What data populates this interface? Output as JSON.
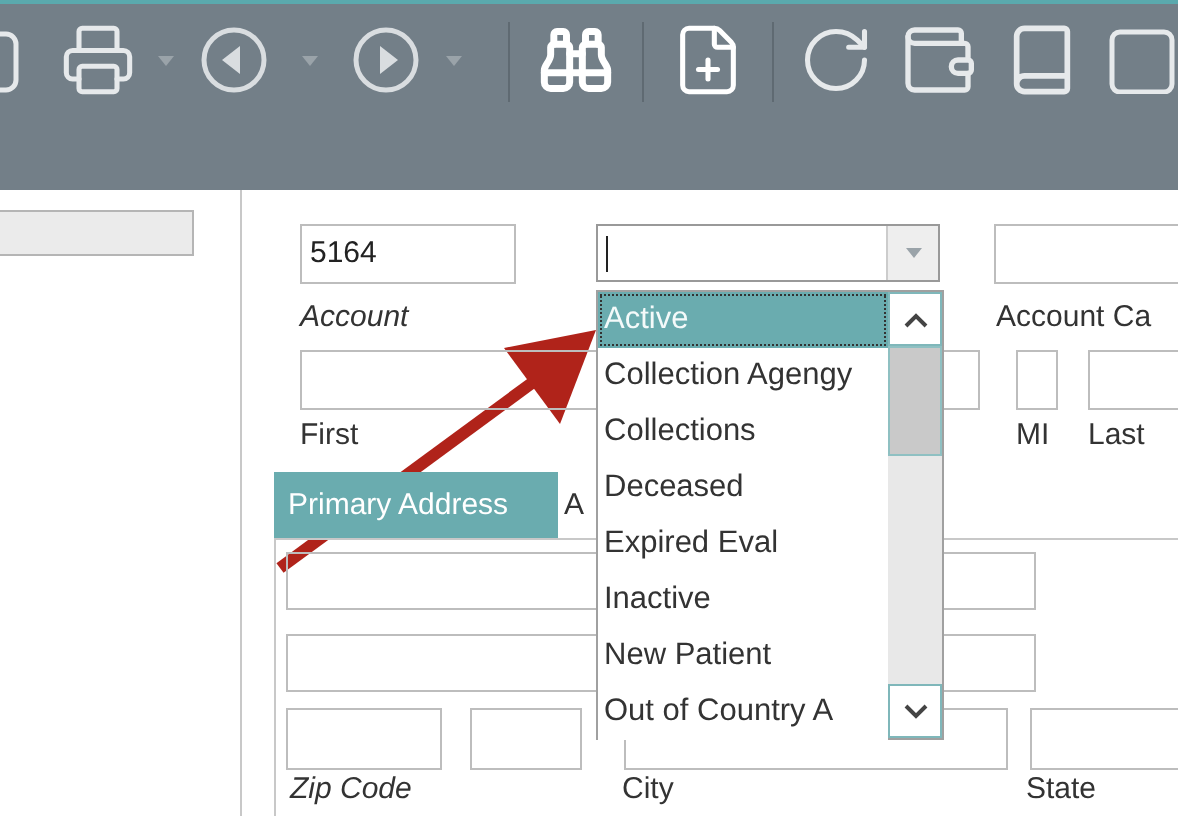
{
  "account": {
    "value": "5164",
    "label": "Account"
  },
  "status_combo": {
    "focused": true
  },
  "status_options": [
    {
      "label": "Active",
      "selected": true
    },
    {
      "label": "Collection Agengy",
      "selected": false
    },
    {
      "label": "Collections",
      "selected": false
    },
    {
      "label": "Deceased",
      "selected": false
    },
    {
      "label": "Expired Eval",
      "selected": false
    },
    {
      "label": "Inactive",
      "selected": false
    },
    {
      "label": "New Patient",
      "selected": false
    },
    {
      "label": "Out of Country A",
      "selected": false
    }
  ],
  "account_category": {
    "label": "Account Ca"
  },
  "name_labels": {
    "first": "First",
    "middle": "MI",
    "last": "Last"
  },
  "tabs": [
    {
      "label": "Primary Address",
      "selected": true
    },
    {
      "label": "A",
      "selected": false
    }
  ],
  "address_labels": {
    "zip": "Zip Code",
    "city": "City",
    "state": "State"
  }
}
